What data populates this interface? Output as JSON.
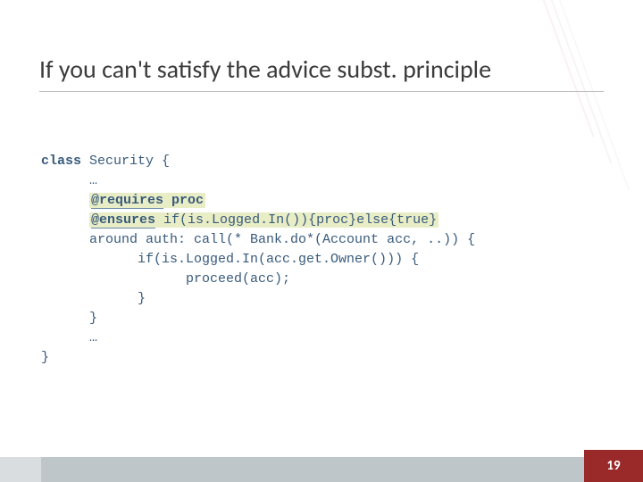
{
  "slide": {
    "title": "If you can't satisfy the advice subst. principle",
    "page_number": "19"
  },
  "code": {
    "l1_a": "class",
    "l1_b": " Security {",
    "l2": "      …",
    "l3_a": "      ",
    "l3_b": "@requires",
    "l3_c": " ",
    "l3_d": "proc",
    "l4_a": "      ",
    "l4_b": "@ensures",
    "l4_c": " ",
    "l4_d": "if(is.Logged.In()){proc}else{true}",
    "l5": "      around auth: call(* Bank.do*(Account acc, ..)) {",
    "l6": "            if(is.Logged.In(acc.get.Owner())) {",
    "l7": "                  proceed(acc);",
    "l8": "            }",
    "l9": "      }",
    "l10": "      …",
    "l11": "}"
  }
}
